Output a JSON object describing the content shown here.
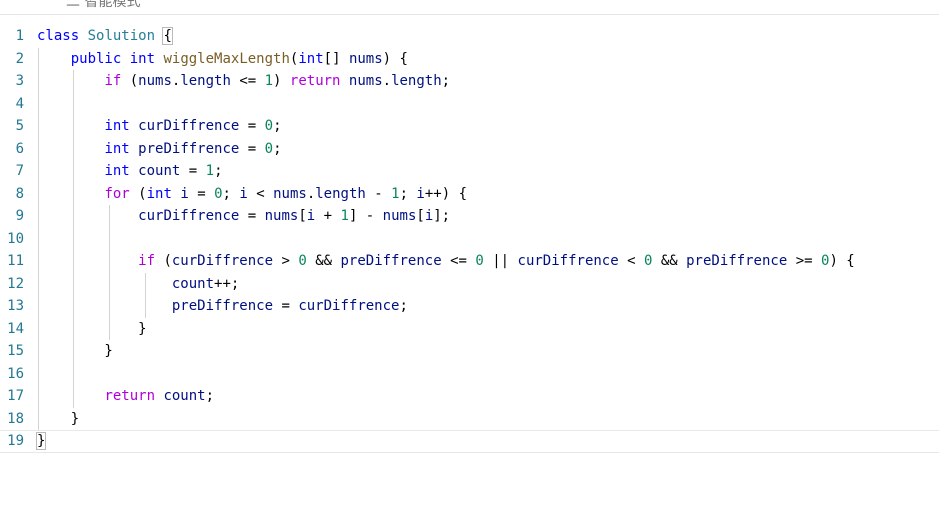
{
  "topbar": {
    "text": "二 智能模式"
  },
  "code_lines": [
    {
      "num": "1",
      "segments": [
        [
          "kw",
          "class"
        ],
        [
          "p",
          " "
        ],
        [
          "ty",
          "Solution"
        ],
        [
          "p",
          " "
        ],
        [
          "bx",
          "{"
        ]
      ]
    },
    {
      "num": "2",
      "segments": [
        [
          "p",
          "    "
        ],
        [
          "kw",
          "public"
        ],
        [
          "p",
          " "
        ],
        [
          "kw",
          "int"
        ],
        [
          "p",
          " "
        ],
        [
          "fn",
          "wiggleMaxLength"
        ],
        [
          "p",
          "("
        ],
        [
          "kw",
          "int"
        ],
        [
          "p",
          "[] "
        ],
        [
          "var",
          "nums"
        ],
        [
          "p",
          ") {"
        ]
      ]
    },
    {
      "num": "3",
      "segments": [
        [
          "p",
          "        "
        ],
        [
          "kw2",
          "if"
        ],
        [
          "p",
          " ("
        ],
        [
          "var",
          "nums"
        ],
        [
          "p",
          "."
        ],
        [
          "var",
          "length"
        ],
        [
          "p",
          " <= "
        ],
        [
          "num",
          "1"
        ],
        [
          "p",
          ") "
        ],
        [
          "kw2",
          "return"
        ],
        [
          "p",
          " "
        ],
        [
          "var",
          "nums"
        ],
        [
          "p",
          "."
        ],
        [
          "var",
          "length"
        ],
        [
          "p",
          ";"
        ]
      ]
    },
    {
      "num": "4",
      "segments": []
    },
    {
      "num": "5",
      "segments": [
        [
          "p",
          "        "
        ],
        [
          "kw",
          "int"
        ],
        [
          "p",
          " "
        ],
        [
          "var",
          "curDiffrence"
        ],
        [
          "p",
          " = "
        ],
        [
          "num",
          "0"
        ],
        [
          "p",
          ";"
        ]
      ]
    },
    {
      "num": "6",
      "segments": [
        [
          "p",
          "        "
        ],
        [
          "kw",
          "int"
        ],
        [
          "p",
          " "
        ],
        [
          "var",
          "preDiffrence"
        ],
        [
          "p",
          " = "
        ],
        [
          "num",
          "0"
        ],
        [
          "p",
          ";"
        ]
      ]
    },
    {
      "num": "7",
      "segments": [
        [
          "p",
          "        "
        ],
        [
          "kw",
          "int"
        ],
        [
          "p",
          " "
        ],
        [
          "var",
          "count"
        ],
        [
          "p",
          " = "
        ],
        [
          "num",
          "1"
        ],
        [
          "p",
          ";"
        ]
      ]
    },
    {
      "num": "8",
      "segments": [
        [
          "p",
          "        "
        ],
        [
          "kw2",
          "for"
        ],
        [
          "p",
          " ("
        ],
        [
          "kw",
          "int"
        ],
        [
          "p",
          " "
        ],
        [
          "var",
          "i"
        ],
        [
          "p",
          " = "
        ],
        [
          "num",
          "0"
        ],
        [
          "p",
          "; "
        ],
        [
          "var",
          "i"
        ],
        [
          "p",
          " < "
        ],
        [
          "var",
          "nums"
        ],
        [
          "p",
          "."
        ],
        [
          "var",
          "length"
        ],
        [
          "p",
          " - "
        ],
        [
          "num",
          "1"
        ],
        [
          "p",
          "; "
        ],
        [
          "var",
          "i"
        ],
        [
          "p",
          "++) {"
        ]
      ]
    },
    {
      "num": "9",
      "segments": [
        [
          "p",
          "            "
        ],
        [
          "var",
          "curDiffrence"
        ],
        [
          "p",
          " = "
        ],
        [
          "var",
          "nums"
        ],
        [
          "p",
          "["
        ],
        [
          "var",
          "i"
        ],
        [
          "p",
          " + "
        ],
        [
          "num",
          "1"
        ],
        [
          "p",
          "] - "
        ],
        [
          "var",
          "nums"
        ],
        [
          "p",
          "["
        ],
        [
          "var",
          "i"
        ],
        [
          "p",
          "];"
        ]
      ]
    },
    {
      "num": "10",
      "segments": []
    },
    {
      "num": "11",
      "segments": [
        [
          "p",
          "            "
        ],
        [
          "kw2",
          "if"
        ],
        [
          "p",
          " ("
        ],
        [
          "var",
          "curDiffrence"
        ],
        [
          "p",
          " > "
        ],
        [
          "num",
          "0"
        ],
        [
          "p",
          " && "
        ],
        [
          "var",
          "preDiffrence"
        ],
        [
          "p",
          " <= "
        ],
        [
          "num",
          "0"
        ],
        [
          "p",
          " || "
        ],
        [
          "var",
          "curDiffrence"
        ],
        [
          "p",
          " < "
        ],
        [
          "num",
          "0"
        ],
        [
          "p",
          " && "
        ],
        [
          "var",
          "preDiffrence"
        ],
        [
          "p",
          " >= "
        ],
        [
          "num",
          "0"
        ],
        [
          "p",
          ") {"
        ]
      ]
    },
    {
      "num": "12",
      "segments": [
        [
          "p",
          "                "
        ],
        [
          "var",
          "count"
        ],
        [
          "p",
          "++;"
        ]
      ]
    },
    {
      "num": "13",
      "segments": [
        [
          "p",
          "                "
        ],
        [
          "var",
          "preDiffrence"
        ],
        [
          "p",
          " = "
        ],
        [
          "var",
          "curDiffrence"
        ],
        [
          "p",
          ";"
        ]
      ]
    },
    {
      "num": "14",
      "segments": [
        [
          "p",
          "            }"
        ]
      ]
    },
    {
      "num": "15",
      "segments": [
        [
          "p",
          "        }"
        ]
      ]
    },
    {
      "num": "16",
      "segments": []
    },
    {
      "num": "17",
      "segments": [
        [
          "p",
          "        "
        ],
        [
          "kw2",
          "return"
        ],
        [
          "p",
          " "
        ],
        [
          "var",
          "count"
        ],
        [
          "p",
          ";"
        ]
      ]
    },
    {
      "num": "18",
      "segments": [
        [
          "p",
          "    }"
        ]
      ]
    },
    {
      "num": "19",
      "segments": [
        [
          "bx",
          "}"
        ]
      ]
    }
  ],
  "current_line": "19",
  "colors": {
    "keyword": "#0000ff",
    "control": "#af00db",
    "type": "#267f99",
    "function": "#795e26",
    "number": "#098658",
    "variable": "#001080",
    "line_number": "#237893"
  }
}
